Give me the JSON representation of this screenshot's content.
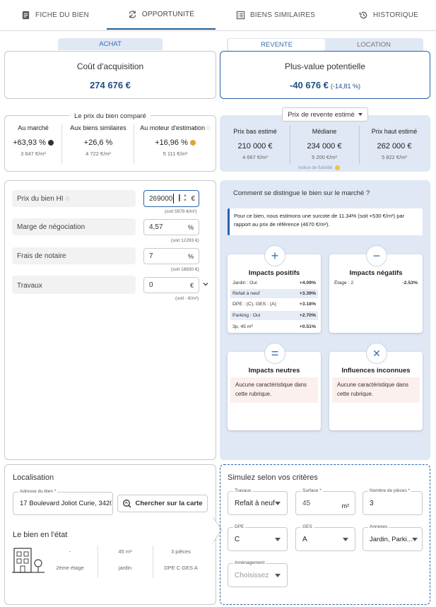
{
  "tabs": [
    {
      "label": "FICHE DU BIEN",
      "icon": "document-icon"
    },
    {
      "label": "OPPORTUNITÉ",
      "icon": "refresh-euro-icon"
    },
    {
      "label": "BIENS SIMILAIRES",
      "icon": "list-icon"
    },
    {
      "label": "HISTORIQUE",
      "icon": "history-icon"
    }
  ],
  "toggle_left": {
    "label": "ACHAT"
  },
  "toggle_right": {
    "a": "REVENTE",
    "b": "LOCATION"
  },
  "acq": {
    "title": "Coût d'acquisition",
    "value": "274 676 €"
  },
  "plusvalue": {
    "title": "Plus-value potentielle",
    "value": "-40 676 €",
    "pct": "(-14,81 %)"
  },
  "compare": {
    "title": "Le prix du bien comparé",
    "cols": [
      {
        "label": "Au marché",
        "value": "+63,93 %",
        "sub": "3 647 €/m²",
        "dot": "#333333"
      },
      {
        "label": "Aux biens similaires",
        "value": "+26,6 %",
        "sub": "4 722 €/m²"
      },
      {
        "label": "Au moteur d'estimation",
        "value": "+16,96 %",
        "sub": "5 111 €/m²",
        "dot": "#e3a23a"
      }
    ]
  },
  "resale": {
    "dropdown": "Prix de revente estimé",
    "cols": [
      {
        "label": "Prix bas estimé",
        "value": "210 000 €",
        "sub": "4 667 €/m²"
      },
      {
        "label": "Médiane",
        "value": "234 000 €",
        "sub": "5 200 €/m²"
      },
      {
        "label": "Prix haut estimé",
        "value": "262 000 €",
        "sub": "5 822 €/m²"
      }
    ],
    "reliability": "Indice de fiabilité",
    "reliability_color": "#f0c24a"
  },
  "inputs": [
    {
      "label": "Prix du bien HI",
      "value": "269000",
      "unit": "€",
      "sub": "(soit 5978 €/m²)"
    },
    {
      "label": "Marge de négociation",
      "value": "4,57",
      "unit": "%",
      "sub": "(soit 12293 €)"
    },
    {
      "label": "Frais de notaire",
      "value": "7",
      "unit": "%",
      "sub": "(soit 18830 €)"
    },
    {
      "label": "Travaux",
      "value": "0",
      "unit": "€",
      "sub": "(soit - €/m²)"
    }
  ],
  "market": {
    "title": "Comment se distingue le bien sur le marché ?",
    "note": "Pour ce bien, nous estimons une surcote de 11.34% (soit +530 €/m²) par rapport au prix de référence (4670 €/m²).",
    "positive": {
      "title": "Impacts positifs",
      "rows": [
        {
          "k": "Jardin : Oui",
          "v": "+4.09%"
        },
        {
          "k": "Refait à neuf",
          "v": "+3.39%"
        },
        {
          "k": "DPE : (C), GES : (A)",
          "v": "+3.18%"
        },
        {
          "k": "Parking : Oui",
          "v": "+2.70%"
        },
        {
          "k": "3p, 45 m²",
          "v": "+0.51%"
        }
      ]
    },
    "negative": {
      "title": "Impacts négatifs",
      "rows": [
        {
          "k": "Étage : 2",
          "v": "-2.53%"
        }
      ]
    },
    "neutral": {
      "title": "Impacts neutres",
      "empty": "Aucune caractéristique dans cette rubrique."
    },
    "unknown": {
      "title": "Influences inconnues",
      "empty": "Aucune caractéristique dans cette rubrique."
    }
  },
  "location": {
    "title": "Localisation",
    "address_label": "Adresse du bien *",
    "address_value": "17 Boulevard Joliot Curie, 3420",
    "map_button": "Chercher sur la carte",
    "state_title": "Le bien en l'état",
    "stats": [
      {
        "top": "-",
        "bottom": "2ème étage"
      },
      {
        "top": "45 m²",
        "bottom": "jardin"
      },
      {
        "top": "3 pièces",
        "bottom": "DPE C  GES A"
      }
    ]
  },
  "simulate": {
    "title": "Simulez selon vos critères",
    "fields": [
      {
        "label": "Travaux",
        "value": "Refait à neuf"
      },
      {
        "label": "Surface *",
        "value": "45",
        "unit": "m²"
      },
      {
        "label": "Nombre de pièces *",
        "value": "3"
      },
      {
        "label": "DPE",
        "value": "C"
      },
      {
        "label": "GES",
        "value": "A"
      },
      {
        "label": "Annexes",
        "value": "Jardin, Parki..."
      },
      {
        "label": "Aménagement",
        "value": "Choisissez"
      }
    ]
  }
}
